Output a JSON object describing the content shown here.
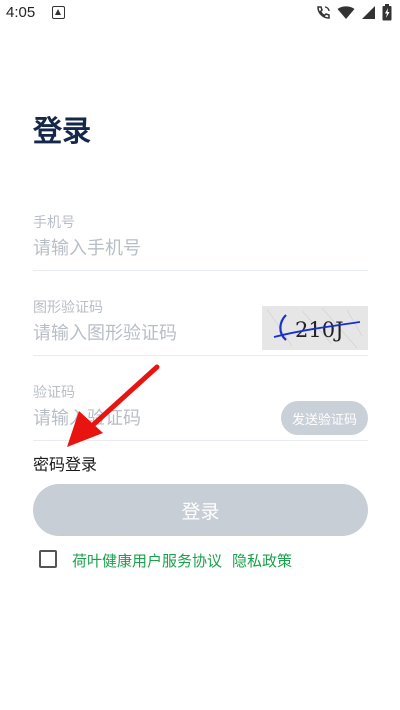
{
  "status_bar": {
    "time": "4:05",
    "icons": [
      "notification-a-icon",
      "wifi-call-icon",
      "wifi-icon",
      "signal-icon",
      "battery-icon"
    ]
  },
  "page": {
    "title": "登录"
  },
  "phone": {
    "label": "手机号",
    "placeholder": "请输入手机号"
  },
  "captcha": {
    "label": "图形验证码",
    "placeholder": "请输入图形验证码",
    "image_text": "210J"
  },
  "sms": {
    "label": "验证码",
    "placeholder": "请输入验证码",
    "send_label": "发送验证码"
  },
  "password_login": "密码登录",
  "login_button": "登录",
  "agreement": {
    "checked": false,
    "service": "荷叶健康用户服务协议",
    "privacy": "隐私政策"
  },
  "colors": {
    "title": "#15274a",
    "placeholder": "#b8bec6",
    "button_disabled": "#c7ced6",
    "link_green": "#1aa14a",
    "annotation_arrow": "#e8140f"
  }
}
